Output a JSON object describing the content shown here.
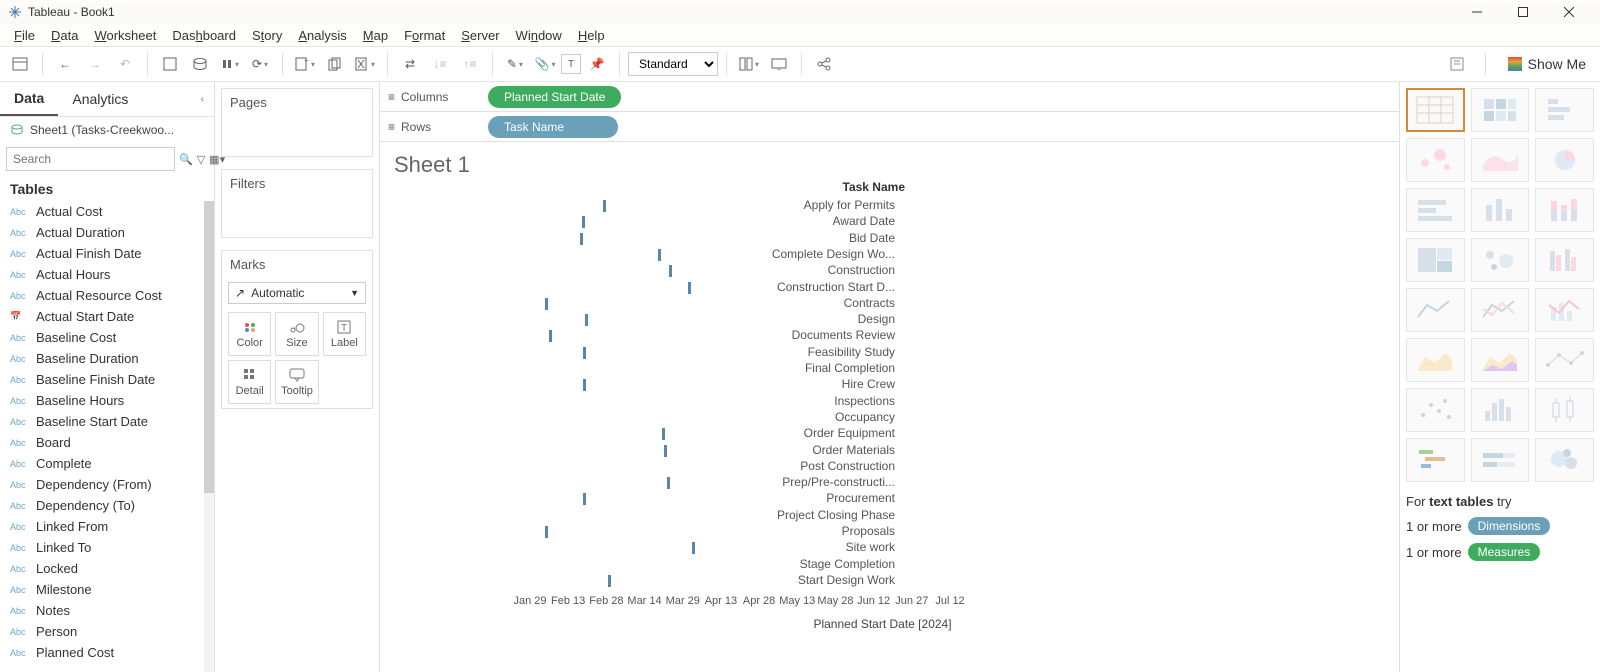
{
  "window": {
    "title": "Tableau - Book1"
  },
  "menu": [
    "File",
    "Data",
    "Worksheet",
    "Dashboard",
    "Story",
    "Analysis",
    "Map",
    "Format",
    "Server",
    "Window",
    "Help"
  ],
  "toolbar": {
    "fit": "Standard"
  },
  "data_panel": {
    "tabs": {
      "data": "Data",
      "analytics": "Analytics"
    },
    "datasource": "Sheet1 (Tasks-Creekwoo...",
    "search_placeholder": "Search",
    "tables_label": "Tables",
    "fields": [
      {
        "type": "Abc",
        "name": "Actual Cost"
      },
      {
        "type": "Abc",
        "name": "Actual Duration"
      },
      {
        "type": "Abc",
        "name": "Actual Finish Date"
      },
      {
        "type": "Abc",
        "name": "Actual Hours"
      },
      {
        "type": "Abc",
        "name": "Actual Resource Cost"
      },
      {
        "type": "date",
        "name": "Actual Start Date"
      },
      {
        "type": "Abc",
        "name": "Baseline Cost"
      },
      {
        "type": "Abc",
        "name": "Baseline Duration"
      },
      {
        "type": "Abc",
        "name": "Baseline Finish Date"
      },
      {
        "type": "Abc",
        "name": "Baseline Hours"
      },
      {
        "type": "Abc",
        "name": "Baseline Start Date"
      },
      {
        "type": "Abc",
        "name": "Board"
      },
      {
        "type": "Abc",
        "name": "Complete"
      },
      {
        "type": "Abc",
        "name": "Dependency (From)"
      },
      {
        "type": "Abc",
        "name": "Dependency (To)"
      },
      {
        "type": "Abc",
        "name": "Linked From"
      },
      {
        "type": "Abc",
        "name": "Linked To"
      },
      {
        "type": "Abc",
        "name": "Locked"
      },
      {
        "type": "Abc",
        "name": "Milestone"
      },
      {
        "type": "Abc",
        "name": "Notes"
      },
      {
        "type": "Abc",
        "name": "Person"
      },
      {
        "type": "Abc",
        "name": "Planned Cost"
      }
    ]
  },
  "cards": {
    "pages": "Pages",
    "filters": "Filters",
    "marks": "Marks",
    "marks_type": "Automatic",
    "mark_items": [
      "Color",
      "Size",
      "Label",
      "Detail",
      "Tooltip"
    ]
  },
  "shelves": {
    "columns_label": "Columns",
    "rows_label": "Rows",
    "columns_pill": "Planned Start Date",
    "rows_pill": "Task Name"
  },
  "sheet_title": "Sheet 1",
  "chart_data": {
    "type": "scatter",
    "row_header": "Task Name",
    "xlabel": "Planned Start Date [2024]",
    "x_ticks": [
      "Jan 29",
      "Feb 13",
      "Feb 28",
      "Mar 14",
      "Mar 29",
      "Apr 13",
      "Apr 28",
      "May 13",
      "May 28",
      "Jun 12",
      "Jun 27",
      "Jul 12"
    ],
    "rows": [
      {
        "label": "Apply for Permits",
        "x": 2.9
      },
      {
        "label": "Award Date",
        "x": 2.35
      },
      {
        "label": "Bid Date",
        "x": 2.3
      },
      {
        "label": "Complete Design Wo...",
        "x": 4.35
      },
      {
        "label": "Construction",
        "x": 4.65
      },
      {
        "label": "Construction Start D...",
        "x": 5.15
      },
      {
        "label": "Contracts",
        "x": 1.4
      },
      {
        "label": "Design",
        "x": 2.45
      },
      {
        "label": "Documents Review",
        "x": 1.5
      },
      {
        "label": "Feasibility Study",
        "x": 2.4
      },
      {
        "label": "Final Completion",
        "x": null
      },
      {
        "label": "Hire Crew",
        "x": 2.4
      },
      {
        "label": "Inspections",
        "x": null
      },
      {
        "label": "Occupancy",
        "x": null
      },
      {
        "label": "Order Equipment",
        "x": 4.45
      },
      {
        "label": "Order Materials",
        "x": 4.5
      },
      {
        "label": "Post Construction",
        "x": null
      },
      {
        "label": "Prep/Pre-constructi...",
        "x": 4.6
      },
      {
        "label": "Procurement",
        "x": 2.4
      },
      {
        "label": "Project Closing Phase",
        "x": null
      },
      {
        "label": "Proposals",
        "x": 1.4
      },
      {
        "label": "Site work",
        "x": 5.25
      },
      {
        "label": "Stage Completion",
        "x": null
      },
      {
        "label": "Start Design Work",
        "x": 3.05
      }
    ]
  },
  "showme": {
    "button": "Show Me",
    "hint_for": "For",
    "hint_bold": "text tables",
    "hint_try": "try",
    "line1": "1 or more",
    "line2": "1 or more",
    "chip_dim": "Dimensions",
    "chip_mea": "Measures"
  }
}
